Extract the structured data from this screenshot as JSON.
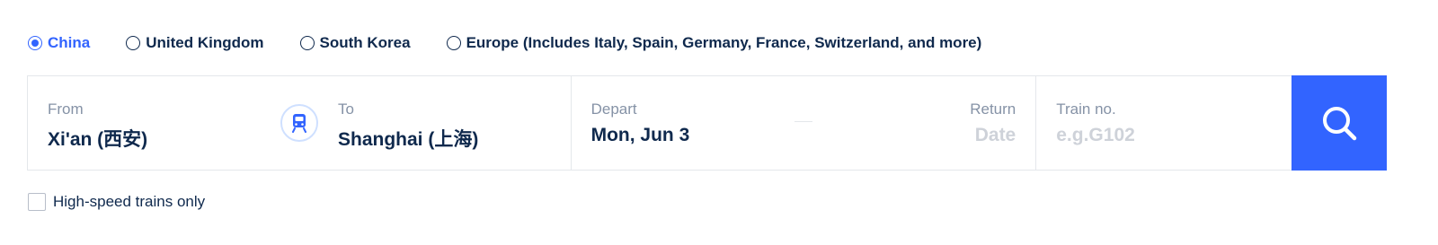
{
  "regions": [
    {
      "label": "China",
      "selected": true
    },
    {
      "label": "United Kingdom",
      "selected": false
    },
    {
      "label": "South Korea",
      "selected": false
    },
    {
      "label": "Europe (Includes Italy, Spain, Germany, France, Switzerland, and more)",
      "selected": false
    }
  ],
  "search": {
    "from_label": "From",
    "from_value": "Xi'an (西安)",
    "to_label": "To",
    "to_value": "Shanghai (上海)",
    "swap_icon": "train-icon",
    "depart_label": "Depart",
    "depart_value": "Mon, Jun 3",
    "return_label": "Return",
    "return_placeholder": "Date",
    "train_no_label": "Train no.",
    "train_no_placeholder": "e.g.G102",
    "search_icon": "search-icon"
  },
  "options": {
    "high_speed_label": "High-speed trains only",
    "high_speed_checked": false
  },
  "colors": {
    "accent": "#3264ff",
    "text": "#0f294d",
    "muted": "#8592a6",
    "placeholder": "#ced2d9",
    "border": "#e4e7eb"
  }
}
